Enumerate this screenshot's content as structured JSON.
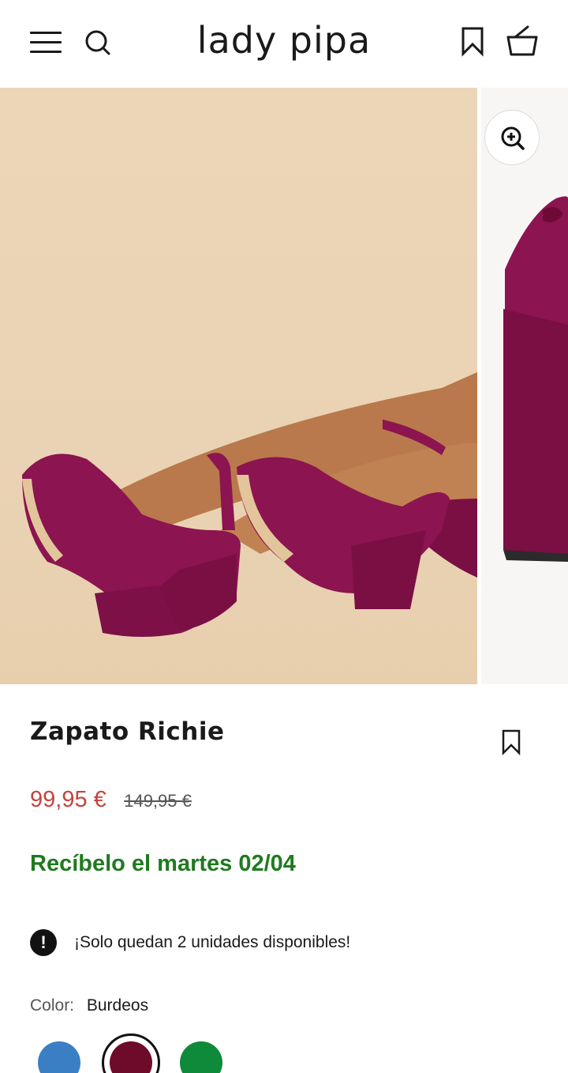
{
  "header": {
    "logo": "lady pipa",
    "icons": [
      "menu-icon",
      "search-icon",
      "bookmark-icon",
      "basket-icon"
    ]
  },
  "product": {
    "title": "Zapato Richie",
    "price_sale": "99,95 €",
    "price_original": "149,95 €",
    "delivery": "Recíbelo el martes 02/04",
    "stock_warning": "¡Solo quedan 2 unidades disponibles!",
    "color_label": "Color:",
    "color_value": "Burdeos",
    "swatches": [
      {
        "name": "blue",
        "color": "#3a7fc4",
        "selected": false
      },
      {
        "name": "burgundy",
        "color": "#6e0a2a",
        "selected": true
      },
      {
        "name": "green",
        "color": "#0e8a3a",
        "selected": false
      }
    ]
  },
  "colors": {
    "sale_price": "#c5433e",
    "delivery_green": "#1f7a1f",
    "shoe_velvet": "#8c1450",
    "backdrop_beige": "#ead3b4"
  }
}
